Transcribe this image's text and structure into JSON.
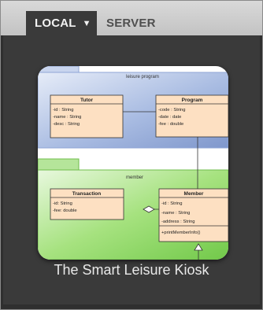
{
  "tabs": {
    "local_label": "LOCAL",
    "local_arrow": "▼",
    "server_label": "SERVER"
  },
  "thumbnail": {
    "package_top": "leisure program",
    "package_bottom": "member",
    "classes": {
      "tutor": {
        "name": "Tutor",
        "attrs": [
          "-id : String",
          "-name : String",
          "-desc : String"
        ]
      },
      "program": {
        "name": "Program",
        "attrs": [
          "-code : String",
          "-date : date",
          "-fee : double"
        ]
      },
      "transaction": {
        "name": "Transaction",
        "attrs": [
          "-id: String",
          "-fee: double"
        ]
      },
      "member": {
        "name": "Member",
        "attrs": [
          "-id : String",
          "-name : String",
          "-address : String"
        ],
        "ops": [
          "+printMemberInfo()"
        ]
      }
    }
  },
  "app_title": "The Smart Leisure Kiosk",
  "colors": {
    "topbar": "#cfcfcf",
    "panel_bg": "#3a3a3a",
    "package_blue": "#9fb3dc",
    "package_green": "#8fd86a",
    "class_fill": "#fde0c2"
  }
}
